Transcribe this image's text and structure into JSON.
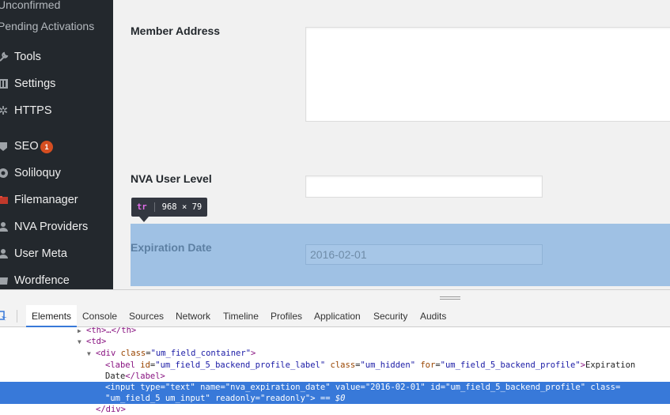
{
  "sidebar": {
    "items": [
      {
        "label": "Unconfirmed",
        "icon": "",
        "sub": true
      },
      {
        "label": "Pending Activations",
        "icon": "",
        "sub": true
      },
      {
        "label": "Tools",
        "icon": "wrench-icon"
      },
      {
        "label": "Settings",
        "icon": "settings-sliders-icon"
      },
      {
        "label": "HTTPS",
        "icon": "gear-icon"
      },
      {
        "label": "SEO",
        "icon": "seo-icon",
        "badge": "1"
      },
      {
        "label": "Soliloquy",
        "icon": "soliloquy-icon"
      },
      {
        "label": "Filemanager",
        "icon": "filemanager-icon"
      },
      {
        "label": "NVA Providers",
        "icon": "user-icon"
      },
      {
        "label": "User Meta",
        "icon": "user-meta-icon"
      },
      {
        "label": "Wordfence",
        "icon": "wordfence-icon"
      }
    ]
  },
  "form": {
    "member_address_label": "Member Address",
    "member_address_value": "",
    "nva_user_level_label": "NVA User Level",
    "nva_user_level_value": "",
    "expiration_date_label": "Expiration Date",
    "expiration_date_value": "2016-02-01"
  },
  "tooltip": {
    "tag": "tr",
    "size": "968 × 79"
  },
  "devtools": {
    "tabs": [
      "Elements",
      "Console",
      "Sources",
      "Network",
      "Timeline",
      "Profiles",
      "Application",
      "Security",
      "Audits"
    ],
    "active_tab": "Elements"
  },
  "dom_tree": {
    "th_line": "<th>…</th>",
    "td_open": "<td>",
    "div_tag": "div",
    "div_class_attr": "class",
    "div_class_value": "um_field_container",
    "label_tag": "label",
    "label_id_value": "um_field_5_backend_profile_label",
    "label_class_value": "um_hidden",
    "label_for_value": "um_field_5_backend_profile",
    "label_text": "Expiration",
    "label_text_cont": "Date",
    "input_type": "text",
    "input_name": "nva_expiration_date",
    "input_value": "2016-02-01",
    "input_id": "um_field_5_backend_profile",
    "input_class": "um_field_5 um_input",
    "input_readonly": "readonly",
    "selected_marker": "== $0",
    "div_close": "</div>"
  },
  "colors": {
    "sidebar_bg": "#23282d",
    "highlight": "#9fc1e4",
    "selected_row": "#3879d9",
    "badge": "#d54e21"
  }
}
